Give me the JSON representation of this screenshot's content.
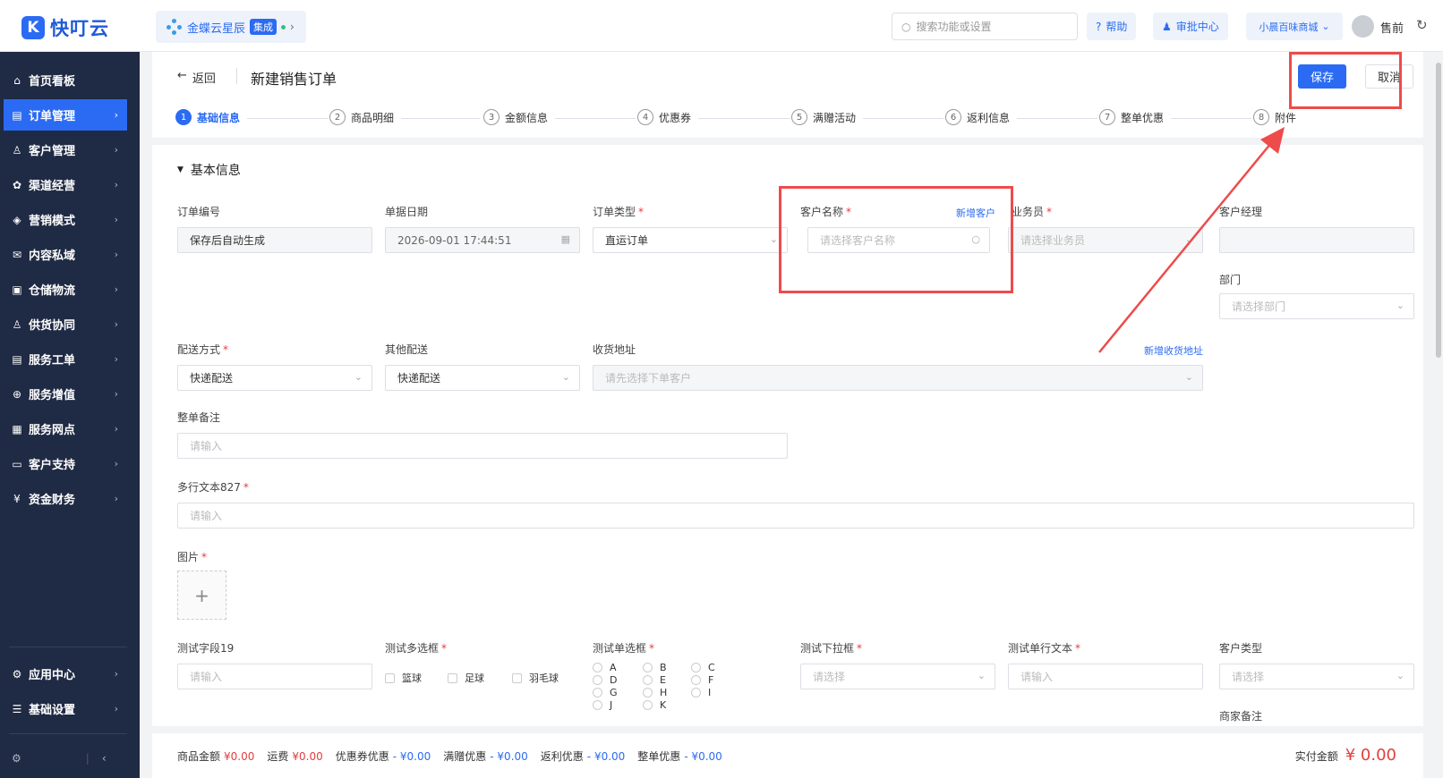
{
  "app": {
    "logo_text": "快叮云",
    "integration_name": "金蝶云星辰",
    "integration_badge": "集成"
  },
  "topbar": {
    "search_placeholder": "搜索功能或设置",
    "help": "帮助",
    "approval": "审批中心",
    "store": "小晨百味商城",
    "user": "售前"
  },
  "sidebar": {
    "items": [
      {
        "icon": "⌂",
        "label": "首页看板",
        "arrow": ""
      },
      {
        "icon": "▤",
        "label": "订单管理",
        "arrow": "›"
      },
      {
        "icon": "♙",
        "label": "客户管理",
        "arrow": "›"
      },
      {
        "icon": "✿",
        "label": "渠道经营",
        "arrow": "›"
      },
      {
        "icon": "◈",
        "label": "营销模式",
        "arrow": "›"
      },
      {
        "icon": "✉",
        "label": "内容私域",
        "arrow": "›"
      },
      {
        "icon": "▣",
        "label": "仓储物流",
        "arrow": "›"
      },
      {
        "icon": "♙",
        "label": "供货协同",
        "arrow": "›"
      },
      {
        "icon": "▤",
        "label": "服务工单",
        "arrow": "›"
      },
      {
        "icon": "⊕",
        "label": "服务增值",
        "arrow": "›"
      },
      {
        "icon": "▦",
        "label": "服务网点",
        "arrow": "›"
      },
      {
        "icon": "▭",
        "label": "客户支持",
        "arrow": "›"
      },
      {
        "icon": "¥",
        "label": "资金财务",
        "arrow": "›"
      },
      {
        "icon": "⚙",
        "label": "应用中心",
        "arrow": "›"
      },
      {
        "icon": "☰",
        "label": "基础设置",
        "arrow": "›"
      }
    ],
    "footer_gear": "⚙",
    "footer_collapse": "‹"
  },
  "page": {
    "back": "返回",
    "title": "新建销售订单",
    "save": "保存",
    "cancel": "取消"
  },
  "steps": [
    {
      "n": "1",
      "label": "基础信息"
    },
    {
      "n": "2",
      "label": "商品明细"
    },
    {
      "n": "3",
      "label": "金额信息"
    },
    {
      "n": "4",
      "label": "优惠券"
    },
    {
      "n": "5",
      "label": "满赠活动"
    },
    {
      "n": "6",
      "label": "返利信息"
    },
    {
      "n": "7",
      "label": "整单优惠"
    },
    {
      "n": "8",
      "label": "附件"
    }
  ],
  "section_title": "基本信息",
  "form": {
    "order_no_label": "订单编号",
    "order_no_value": "保存后自动生成",
    "date_label": "单据日期",
    "date_value": "2026-09-01 17:44:51",
    "order_type_label": "订单类型",
    "order_type_value": "直运订单",
    "customer_label": "客户名称",
    "customer_new": "新增客户",
    "customer_placeholder": "请选择客户名称",
    "salesman_label": "业务员",
    "salesman_placeholder": "请选择业务员",
    "manager_label": "客户经理",
    "dept_label": "部门",
    "dept_placeholder": "请选择部门",
    "delivery_label": "配送方式",
    "delivery_value": "快递配送",
    "other_delivery_label": "其他配送",
    "other_delivery_value": "快递配送",
    "address_label": "收货地址",
    "address_new": "新增收货地址",
    "address_placeholder": "请先选择下单客户",
    "remark_label": "整单备注",
    "remark_placeholder": "请输入",
    "multitext_label": "多行文本827",
    "multitext_placeholder": "请输入",
    "image_label": "图片",
    "test19_label": "测试字段19",
    "test19_placeholder": "请输入",
    "multi_label": "测试多选框",
    "multi_options": [
      "篮球",
      "足球",
      "羽毛球"
    ],
    "radio_label": "测试单选框",
    "radio_options": [
      "A",
      "B",
      "C",
      "D",
      "E",
      "F",
      "G",
      "H",
      "I",
      "J",
      "K"
    ],
    "dropdown_label": "测试下拉框",
    "dropdown_placeholder": "请选择",
    "single_label": "测试单行文本",
    "single_placeholder": "请输入",
    "custtype_label": "客户类型",
    "custtype_placeholder": "请选择",
    "merchant_label": "商家备注"
  },
  "summary": {
    "items": [
      {
        "label": "商品金额",
        "value": "¥0.00",
        "kind": "r"
      },
      {
        "label": "运费",
        "value": "¥0.00",
        "kind": "r"
      },
      {
        "label": "优惠券优惠",
        "value": "- ¥0.00",
        "kind": "b"
      },
      {
        "label": "满赠优惠",
        "value": "- ¥0.00",
        "kind": "b"
      },
      {
        "label": "返利优惠",
        "value": "- ¥0.00",
        "kind": "b"
      },
      {
        "label": "整单优惠",
        "value": "- ¥0.00",
        "kind": "b"
      }
    ],
    "total_label": "实付金额",
    "total_value": "¥ 0.00"
  },
  "colors": {
    "accent": "#2b6bf3",
    "sidebar": "#1f2a44",
    "annotation": "#ee4b4b"
  }
}
